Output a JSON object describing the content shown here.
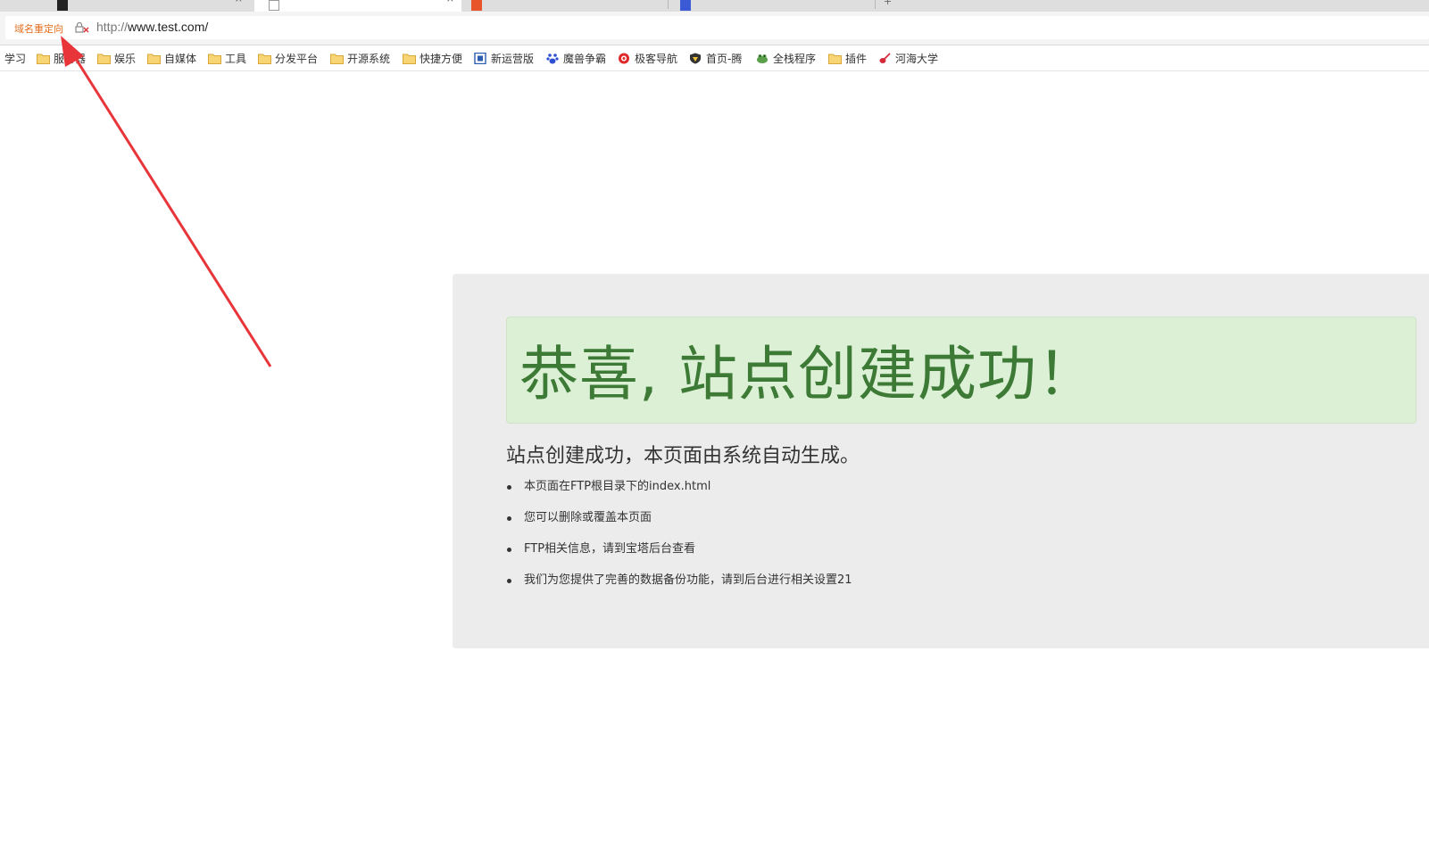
{
  "tabs": [
    {
      "label": "",
      "active": false
    },
    {
      "label": "",
      "active": true
    },
    {
      "label": "",
      "active": false
    },
    {
      "label": "",
      "active": false
    }
  ],
  "address_bar": {
    "redirect_label": "域名重定向",
    "url_protocol": "http://",
    "url_host": "www.test.com/",
    "security_icon": "insecure-lock-icon"
  },
  "bookmarks": [
    {
      "label": "学习",
      "icon": "none"
    },
    {
      "label": "服务器",
      "icon": "folder-icon"
    },
    {
      "label": "娱乐",
      "icon": "folder-icon"
    },
    {
      "label": "自媒体",
      "icon": "folder-icon"
    },
    {
      "label": "工具",
      "icon": "folder-icon"
    },
    {
      "label": "分发平台",
      "icon": "folder-icon"
    },
    {
      "label": "开源系统",
      "icon": "folder-icon"
    },
    {
      "label": "快捷方便",
      "icon": "folder-icon"
    },
    {
      "label": "新运营版",
      "icon": "site-icon"
    },
    {
      "label": "魔兽争霸",
      "icon": "paw-icon"
    },
    {
      "label": "极客导航",
      "icon": "target-icon"
    },
    {
      "label": "首页-腾",
      "icon": "shield-icon"
    },
    {
      "label": "全栈程序",
      "icon": "frog-icon"
    },
    {
      "label": "插件",
      "icon": "folder-icon"
    },
    {
      "label": "河海大学",
      "icon": "guitar-icon"
    }
  ],
  "page": {
    "headline": "恭喜, 站点创建成功！",
    "subtitle": "站点创建成功，本页面由系统自动生成。",
    "bullets": [
      "本页面在FTP根目录下的index.html",
      "您可以删除或覆盖本页面",
      "FTP相关信息，请到宝塔后台查看",
      "我们为您提供了完善的数据备份功能，请到后台进行相关设置21"
    ]
  },
  "colors": {
    "redirect_label": "#e36d1d",
    "headline": "#3c7a35",
    "jumbotron_bg": "#dcf0d6",
    "panel_bg": "#ececec",
    "arrow": "#e8353a",
    "folder": "#f3c45a"
  }
}
